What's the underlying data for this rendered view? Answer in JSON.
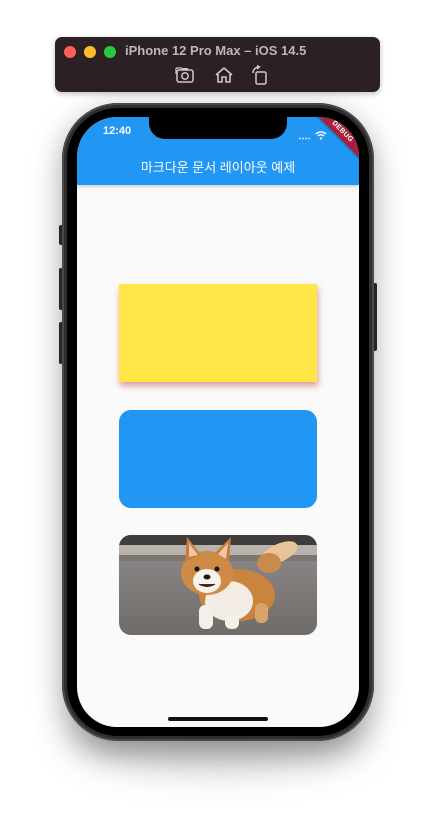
{
  "simulator": {
    "title": "iPhone 12 Pro Max – iOS 14.5",
    "toolbar_icons": [
      "screenshot-icon",
      "home-icon",
      "rotate-icon"
    ]
  },
  "status_bar": {
    "time": "12:40",
    "debug_label": "DEBUG"
  },
  "app_bar": {
    "title": "마크다운 문서 레이아웃 예제",
    "color": "#2196f3"
  },
  "boxes": [
    {
      "name": "yellow-box",
      "color": "#ffe545",
      "shape": "square-with-shadow"
    },
    {
      "name": "blue-box",
      "color": "#2196f3",
      "shape": "rounded"
    },
    {
      "name": "corgi-image",
      "content": "photo of a corgi dog",
      "shape": "rounded"
    }
  ]
}
